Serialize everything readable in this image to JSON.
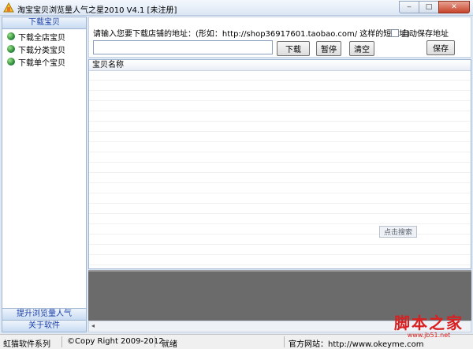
{
  "window": {
    "title": "淘宝宝贝浏览量人气之星2010  V4.1 [未注册]",
    "buttons": {
      "minimize": "‒",
      "maximize": "□",
      "close": "✕"
    }
  },
  "sidebar": {
    "header": "下载宝贝",
    "items": [
      {
        "label": "下载全店宝贝",
        "icon": "globe-icon"
      },
      {
        "label": "下载分类宝贝",
        "icon": "globe-icon"
      },
      {
        "label": "下载单个宝贝",
        "icon": "globe-icon"
      }
    ],
    "bottom_items": [
      "提升浏览量人气",
      "关于软件"
    ]
  },
  "toolbar": {
    "prompt": "请输入您要下载店铺的地址：(形如：http://shop36917601.taobao.com/   这样的短地址)",
    "url_value": "",
    "download_label": "下载",
    "pause_label": "暂停",
    "clear_label": "清空",
    "autosave_label": "自动保存地址",
    "autosave_checked": false,
    "save_label": "保存"
  },
  "list": {
    "columns": [
      "宝贝名称"
    ],
    "search_tag": "点击搜索"
  },
  "statusbar": {
    "company": "虹猫软件系列",
    "copyright": "©Copy Right 2009-2012",
    "status": "就绪",
    "website": "官方网站：http://www.okeyme.com"
  },
  "watermark": {
    "main": "脚本之家",
    "sub": "www.jb51.net"
  },
  "colors": {
    "accent": "#1a3fa8",
    "dark_panel": "#6b6b6b",
    "close_button": "#c7432a",
    "watermark": "#d91f1f"
  }
}
